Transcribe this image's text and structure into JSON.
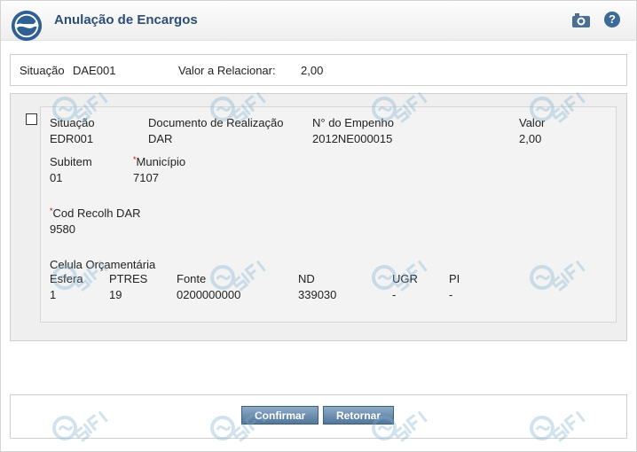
{
  "header": {
    "title": "Anulação de Encargos",
    "camera_icon": "camera-icon",
    "help_icon": "help-icon",
    "help_glyph": "?"
  },
  "summary": {
    "situacao_label": "Situação",
    "situacao_value": "DAE001",
    "valor_label": "Valor a Relacionar:",
    "valor_value": "2,00"
  },
  "item": {
    "situacao_label": "Situação",
    "situacao_value": "EDR001",
    "documento_label": "Documento de Realização",
    "documento_value": "DAR",
    "empenho_label": "N° do Empenho",
    "empenho_value": "2012NE000015",
    "valor_label": "Valor",
    "valor_value": "2,00",
    "subitem_label": "Subitem",
    "subitem_value": "01",
    "municipio_label": "Município",
    "municipio_value": "7107",
    "cod_recolh_label": "Cod Recolh DAR",
    "cod_recolh_value": "9580",
    "celula_label": "Celula Orçamentária",
    "celula_columns": [
      "Esfera",
      "PTRES",
      "Fonte",
      "ND",
      "UGR",
      "PI"
    ],
    "celula_values": [
      "1",
      "19",
      "0200000000",
      "339030",
      "-",
      "-"
    ]
  },
  "required_marker": "*",
  "footer": {
    "confirm_label": "Confirmar",
    "return_label": "Retornar"
  },
  "colors": {
    "title": "#2c4e76",
    "button": "#52769a",
    "required": "#cc0000",
    "watermark": "#7eb0cf"
  }
}
